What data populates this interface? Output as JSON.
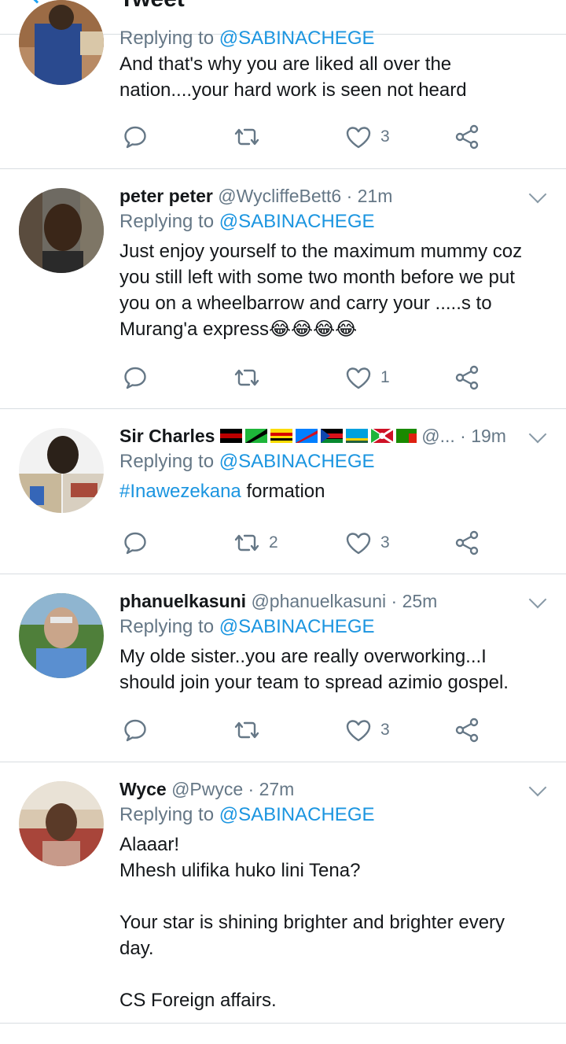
{
  "header": {
    "title": "Tweet"
  },
  "tweets": [
    {
      "name": "",
      "handle": "",
      "time": "",
      "reply_label": "Replying to",
      "reply_handle": "@SABINACHEGE",
      "body": "And that's why you are liked all over the\nnation....your hard work is seen not heard",
      "replies": "",
      "retweets": "",
      "likes": "3"
    },
    {
      "name": "peter peter",
      "handle": "@WycliffeBett6",
      "time": "· 21m",
      "reply_label": "Replying to",
      "reply_handle": "@SABINACHEGE",
      "body": "Just enjoy yourself to the maximum mummy coz\nyou still left with some two month before we put\nyou on a wheelbarrow and carry your .....s to\nMurang'a express😂😂😂😂",
      "replies": "",
      "retweets": "",
      "likes": "1"
    },
    {
      "name": "Sir Charles",
      "handle": "@...",
      "time": "· 19m",
      "reply_label": "Replying to",
      "reply_handle": "@SABINACHEGE",
      "hashtag": "#Inawezekana",
      "body": " formation",
      "replies": "",
      "retweets": "2",
      "likes": "3"
    },
    {
      "name": "phanuelkasuni",
      "handle": "@phanuelkasuni",
      "time": "· 25m",
      "reply_label": "Replying to",
      "reply_handle": "@SABINACHEGE",
      "body": "My olde sister..you are really overworking...I\nshould join your team to spread azimio gospel.",
      "replies": "",
      "retweets": "",
      "likes": "3"
    },
    {
      "name": "Wyce",
      "handle": "@Pwyce",
      "time": "· 27m",
      "reply_label": "Replying to",
      "reply_handle": "@SABINACHEGE",
      "body": "Alaaar!\nMhesh ulifika huko lini Tena?\n\nYour star is shining brighter and brighter every\nday.\n\nCS Foreign affairs."
    }
  ],
  "colors": {
    "accent": "#1b95e0",
    "muted": "#657786",
    "text": "#14171a",
    "divider": "#d8dde1"
  },
  "icons": {
    "reply": "reply-icon",
    "retweet": "retweet-icon",
    "like": "heart-icon",
    "share": "share-icon",
    "menu": "chevron-down-icon"
  }
}
